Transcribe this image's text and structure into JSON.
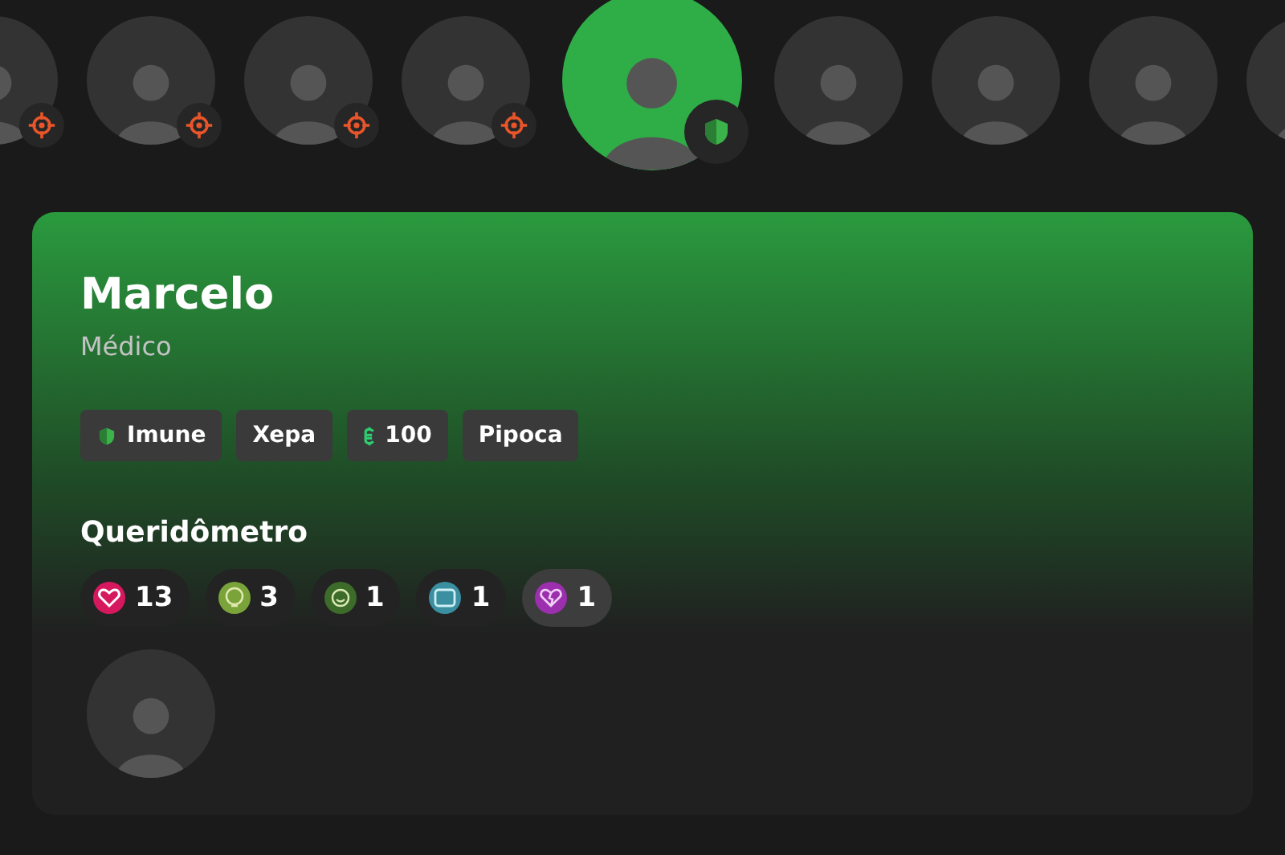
{
  "participants": [
    {
      "selected": false,
      "kind": "target"
    },
    {
      "selected": false,
      "kind": "target"
    },
    {
      "selected": false,
      "kind": "target"
    },
    {
      "selected": false,
      "kind": "target"
    },
    {
      "selected": true,
      "kind": "shield"
    },
    {
      "selected": false,
      "kind": "plain"
    },
    {
      "selected": false,
      "kind": "plain"
    },
    {
      "selected": false,
      "kind": "plain"
    },
    {
      "selected": false,
      "kind": "plain"
    }
  ],
  "profile": {
    "name": "Marcelo",
    "occupation": "Médico",
    "tags": [
      {
        "kind": "shield",
        "label": "Imune"
      },
      {
        "kind": "plain",
        "label": "Xepa"
      },
      {
        "kind": "money",
        "label": "100"
      },
      {
        "kind": "plain",
        "label": "Pipoca"
      }
    ],
    "section_title": "Queridômetro",
    "reactions": [
      {
        "kind": "heart",
        "color": "#d6185f",
        "count": "13",
        "selected": false
      },
      {
        "kind": "face",
        "color": "#7aa33a",
        "count": "3",
        "selected": false
      },
      {
        "kind": "smile",
        "color": "#3d6b2a",
        "count": "1",
        "selected": false
      },
      {
        "kind": "box",
        "color": "#3a8fa0",
        "count": "1",
        "selected": false
      },
      {
        "kind": "broken-heart",
        "color": "#9b2fae",
        "count": "1",
        "selected": true
      }
    ],
    "givers": [
      {
        "selected": false
      }
    ]
  }
}
